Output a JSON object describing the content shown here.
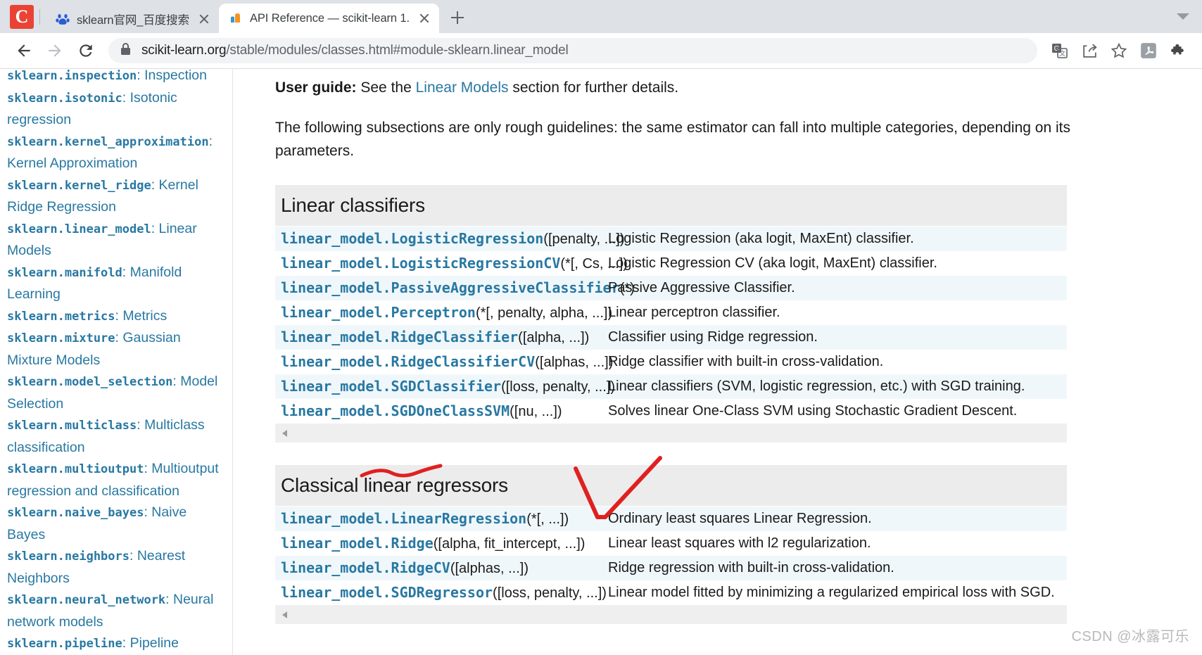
{
  "browser": {
    "tabs": [
      {
        "title": "sklearn官网_百度搜索",
        "favicon": "baidu-icon",
        "active": false
      },
      {
        "title": "API Reference — scikit-learn 1.",
        "favicon": "scikit-learn-icon",
        "active": true
      }
    ],
    "new_tab_label": "+",
    "toolbar": {
      "back_label": "Back",
      "forward_label": "Forward",
      "reload_label": "Reload",
      "url_secure": "scikit-learn.org",
      "url_path": "/stable/modules/classes.html#module-sklearn.linear_model",
      "icons": [
        "translate-icon",
        "share-icon",
        "bookmark-star-icon",
        "adobe-acrobat-icon",
        "extensions-puzzle-icon"
      ]
    }
  },
  "sidebar": {
    "items": [
      {
        "module": "sklearn.inspection",
        "desc": ": Inspection"
      },
      {
        "module": "sklearn.isotonic",
        "desc": ": Isotonic regression"
      },
      {
        "module": "sklearn.kernel_approximation",
        "desc": ": Kernel Approximation"
      },
      {
        "module": "sklearn.kernel_ridge",
        "desc": ": Kernel Ridge Regression"
      },
      {
        "module": "sklearn.linear_model",
        "desc": ": Linear Models"
      },
      {
        "module": "sklearn.manifold",
        "desc": ": Manifold Learning"
      },
      {
        "module": "sklearn.metrics",
        "desc": ": Metrics"
      },
      {
        "module": "sklearn.mixture",
        "desc": ": Gaussian Mixture Models"
      },
      {
        "module": "sklearn.model_selection",
        "desc": ": Model Selection"
      },
      {
        "module": "sklearn.multiclass",
        "desc": ": Multiclass classification"
      },
      {
        "module": "sklearn.multioutput",
        "desc": ": Multioutput regression and classification"
      },
      {
        "module": "sklearn.naive_bayes",
        "desc": ": Naive Bayes"
      },
      {
        "module": "sklearn.neighbors",
        "desc": ": Nearest Neighbors"
      },
      {
        "module": "sklearn.neural_network",
        "desc": ": Neural network models"
      },
      {
        "module": "sklearn.pipeline",
        "desc": ": Pipeline"
      }
    ]
  },
  "main": {
    "user_guide_label": "User guide:",
    "user_guide_pre": " See the ",
    "user_guide_link": "Linear Models",
    "user_guide_post": " section for further details.",
    "intro_paragraph": "The following subsections are only rough guidelines: the same estimator can fall into multiple categories, depending on its",
    "intro_paragraph_line2": "parameters.",
    "sections": [
      {
        "heading": "Linear classifiers",
        "rows": [
          {
            "name": "linear_model.LogisticRegression",
            "args": "([penalty, ...])",
            "desc": "Logistic Regression (aka logit, MaxEnt) classifier."
          },
          {
            "name": "linear_model.LogisticRegressionCV",
            "args": "(*[, Cs, ...])",
            "desc": "Logistic Regression CV (aka logit, MaxEnt) classifier."
          },
          {
            "name": "linear_model.PassiveAggressiveClassifier",
            "args": "(*)",
            "desc": "Passive Aggressive Classifier."
          },
          {
            "name": "linear_model.Perceptron",
            "args": "(*[, penalty, alpha, ...])",
            "desc": "Linear perceptron classifier."
          },
          {
            "name": "linear_model.RidgeClassifier",
            "args": "([alpha, ...])",
            "desc": "Classifier using Ridge regression."
          },
          {
            "name": "linear_model.RidgeClassifierCV",
            "args": "([alphas, ...])",
            "desc": "Ridge classifier with built-in cross-validation."
          },
          {
            "name": "linear_model.SGDClassifier",
            "args": "([loss, penalty, ...])",
            "desc": "Linear classifiers (SVM, logistic regression, etc.) with SGD training."
          },
          {
            "name": "linear_model.SGDOneClassSVM",
            "args": "([nu, ...])",
            "desc": "Solves linear One-Class SVM using Stochastic Gradient Descent."
          }
        ]
      },
      {
        "heading": "Classical linear regressors",
        "rows": [
          {
            "name": "linear_model.LinearRegression",
            "args": "(*[, ...])",
            "desc": "Ordinary least squares Linear Regression."
          },
          {
            "name": "linear_model.Ridge",
            "args": "([alpha, fit_intercept, ...])",
            "desc": "Linear least squares with l2 regularization."
          },
          {
            "name": "linear_model.RidgeCV",
            "args": "([alphas, ...])",
            "desc": "Ridge regression with built-in cross-validation."
          },
          {
            "name": "linear_model.SGDRegressor",
            "args": "([loss, penalty, ...])",
            "desc": "Linear model fitted by minimizing a regularized empirical loss with SGD."
          }
        ]
      }
    ]
  },
  "annotations": {
    "color": "#e02020",
    "marks": [
      "squiggle-underline",
      "check-mark-v"
    ]
  },
  "watermark": "CSDN @冰露可乐",
  "colors": {
    "link": "#2878a2",
    "row_alt": "#f0f7fa",
    "section_bg": "#ececec",
    "annotation_red": "#e02020"
  }
}
